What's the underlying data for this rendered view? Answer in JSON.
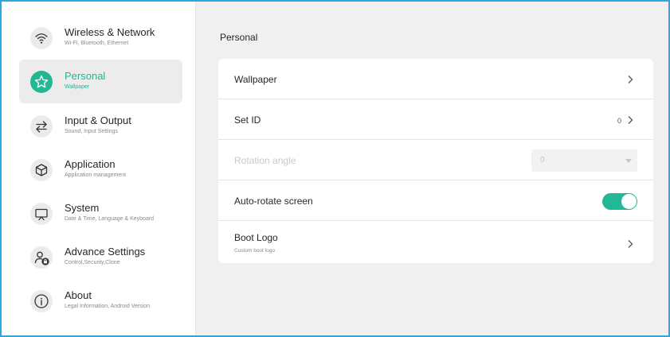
{
  "sidebar": {
    "items": [
      {
        "title": "Wireless & Network",
        "subtitle": "Wi-Fi, Bluetooth, Ethernet",
        "icon": "wifi-icon"
      },
      {
        "title": "Personal",
        "subtitle": "Wallpaper",
        "icon": "star-icon",
        "active": true
      },
      {
        "title": "Input & Output",
        "subtitle": "Sound, Input Settings",
        "icon": "swap-arrows-icon"
      },
      {
        "title": "Application",
        "subtitle": "Application management",
        "icon": "app-cube-icon"
      },
      {
        "title": "System",
        "subtitle": "Date & Time, Language & Keyboard",
        "icon": "monitor-icon"
      },
      {
        "title": "Advance Settings",
        "subtitle": "Control,Security,Clone",
        "icon": "user-lock-icon"
      },
      {
        "title": "About",
        "subtitle": "Legal Information, Android Version",
        "icon": "info-icon"
      }
    ]
  },
  "main": {
    "title": "Personal",
    "rows": {
      "wallpaper": {
        "label": "Wallpaper"
      },
      "set_id": {
        "label": "Set ID",
        "value": "0"
      },
      "rotation": {
        "label": "Rotation angle",
        "value": "0",
        "disabled": true
      },
      "auto_rotate": {
        "label": "Auto-rotate screen",
        "enabled": true
      },
      "boot_logo": {
        "label": "Boot Logo",
        "subtitle": "Custom boot logo"
      }
    }
  },
  "colors": {
    "accent": "#22b795",
    "frame_border": "#2ea7e0",
    "active_bg": "#ececec"
  }
}
